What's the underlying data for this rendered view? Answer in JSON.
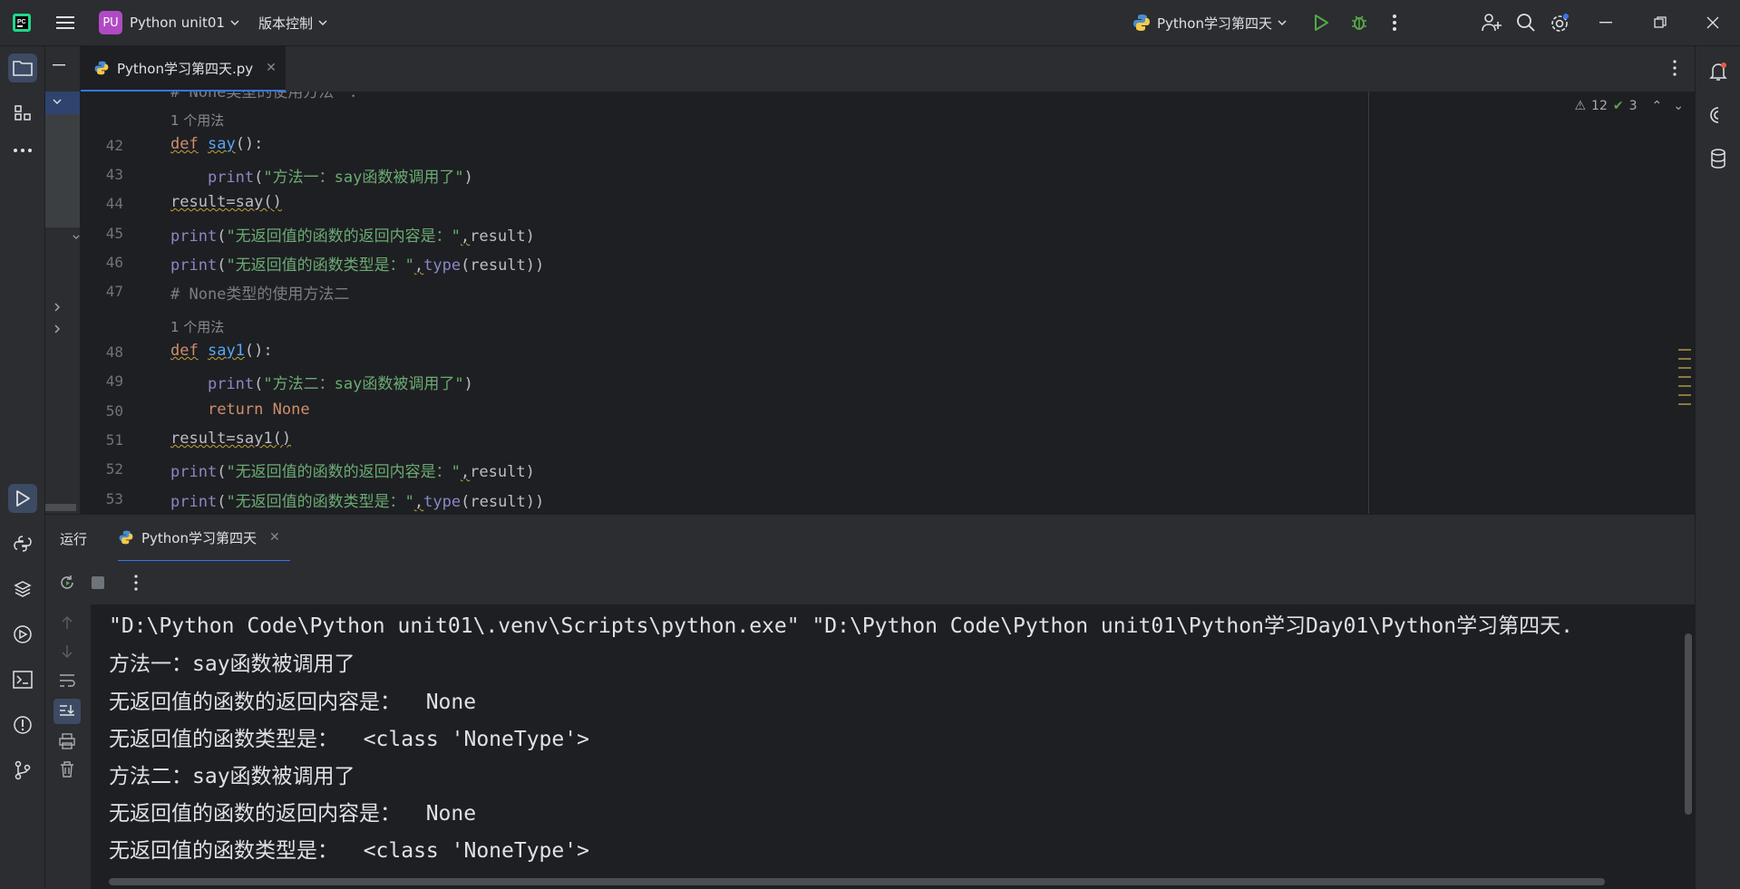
{
  "titlebar": {
    "project_badge": "PU",
    "project_name": "Python unit01",
    "vcs_label": "版本控制",
    "run_config": "Python学习第四天"
  },
  "editor": {
    "tab_label": "Python学习第四天.py",
    "inspection": {
      "warnings": "12",
      "ok": "3"
    },
    "partial_top_line": "# None类型的使用方法一：",
    "usage_hint_1": "1 个用法",
    "usage_hint_2": "1 个用法",
    "line_numbers": [
      "42",
      "43",
      "44",
      "45",
      "46",
      "47",
      "48",
      "49",
      "50",
      "51",
      "52",
      "53"
    ]
  },
  "run_panel": {
    "title": "运行",
    "tab_label": "Python学习第四天",
    "console_lines": [
      "\"D:\\Python Code\\Python unit01\\.venv\\Scripts\\python.exe\" \"D:\\Python Code\\Python unit01\\Python学习Day01\\Python学习第四天.",
      "方法一：say函数被调用了",
      "无返回值的函数的返回内容是：  None",
      "无返回值的函数类型是：  <class 'NoneType'>",
      "方法二：say函数被调用了",
      "无返回值的函数的返回内容是：  None",
      "无返回值的函数类型是：  <class 'NoneType'>"
    ]
  },
  "colors": {
    "accent": "#3574f0",
    "keyword": "#cf8e6d",
    "string": "#6aab73",
    "builtin": "#8888c6",
    "function": "#56a8f5"
  }
}
